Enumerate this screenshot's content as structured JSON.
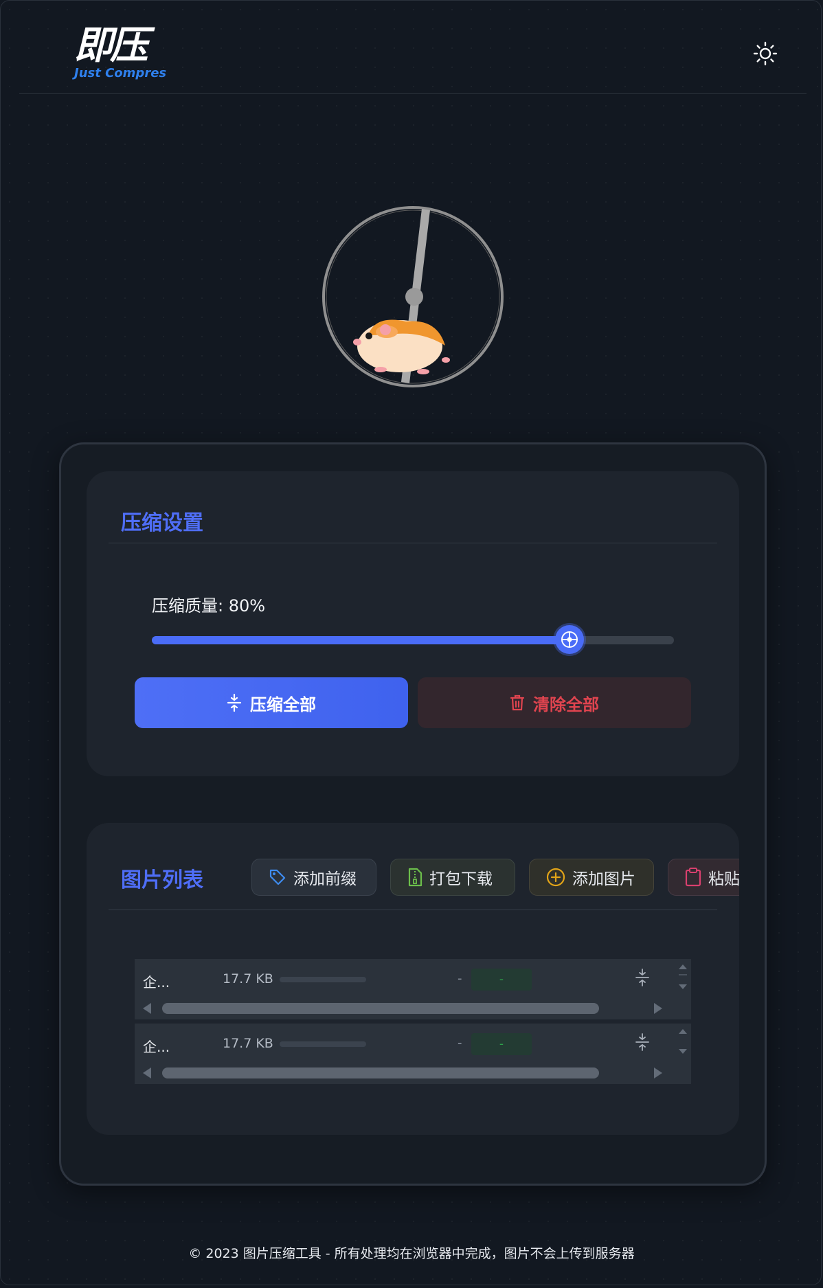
{
  "header": {
    "logo_main": "即压",
    "logo_sub": "Just Compres",
    "theme_toggle_icon": "sun-icon"
  },
  "settings": {
    "title": "压缩设置",
    "quality_label": "压缩质量: 80%",
    "quality_value": 80,
    "compress_all_label": "压缩全部",
    "clear_all_label": "清除全部",
    "accent_color": "#4a6cf7",
    "danger_color": "#e0444f"
  },
  "image_list": {
    "title": "图片列表",
    "actions": {
      "add_prefix": "添加前缀",
      "zip_download": "打包下载",
      "add_image": "添加图片",
      "paste": "粘贴"
    },
    "rows": [
      {
        "name": "企...",
        "size": "17.7 KB",
        "new_size": "-",
        "saving": "-"
      },
      {
        "name": "企...",
        "size": "17.7 KB",
        "new_size": "-",
        "saving": "-"
      }
    ]
  },
  "footer": {
    "text": "© 2023 图片压缩工具 - 所有处理均在浏览器中完成，图片不会上传到服务器"
  }
}
